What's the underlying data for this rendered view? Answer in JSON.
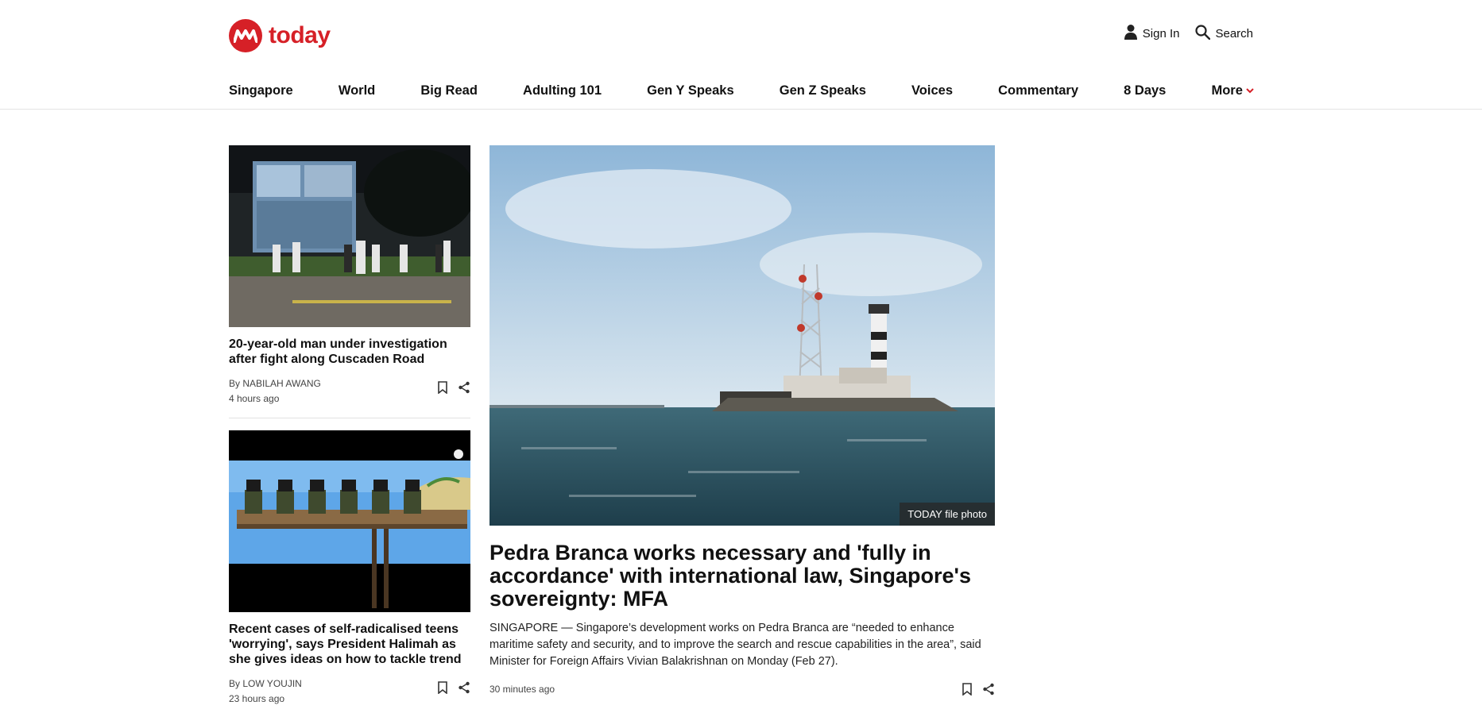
{
  "brand": {
    "name": "today",
    "color": "#d62027"
  },
  "header": {
    "sign_in": "Sign In",
    "search": "Search"
  },
  "nav": {
    "items": [
      "Singapore",
      "World",
      "Big Read",
      "Adulting 101",
      "Gen Y Speaks",
      "Gen Z Speaks",
      "Voices",
      "Commentary",
      "8 Days"
    ],
    "more": "More"
  },
  "articles": [
    {
      "title": "20-year-old man under investigation after fight along Cuscaden Road",
      "by": "By",
      "author": "NABILAH AWANG",
      "time": "4 hours ago"
    },
    {
      "title": "Recent cases of self-radicalised teens 'worrying', says President Halimah as she gives ideas on how to tackle trend",
      "by": "By",
      "author": "LOW YOUJIN",
      "time": "23 hours ago"
    }
  ],
  "feature": {
    "caption": "TODAY file photo",
    "title": "Pedra Branca works necessary and 'fully in accordance' with international law, Singapore's sovereignty: MFA",
    "body": "SINGAPORE — Singapore’s development works on Pedra Branca are “needed to enhance maritime safety and security, and to improve the search and rescue capabilities in the area”, said Minister for Foreign Affairs Vivian Balakrishnan on Monday (Feb 27).",
    "time": "30 minutes ago"
  },
  "icons": [
    "user-icon",
    "search-icon",
    "bookmark-icon",
    "share-icon",
    "chevron-down-icon"
  ]
}
